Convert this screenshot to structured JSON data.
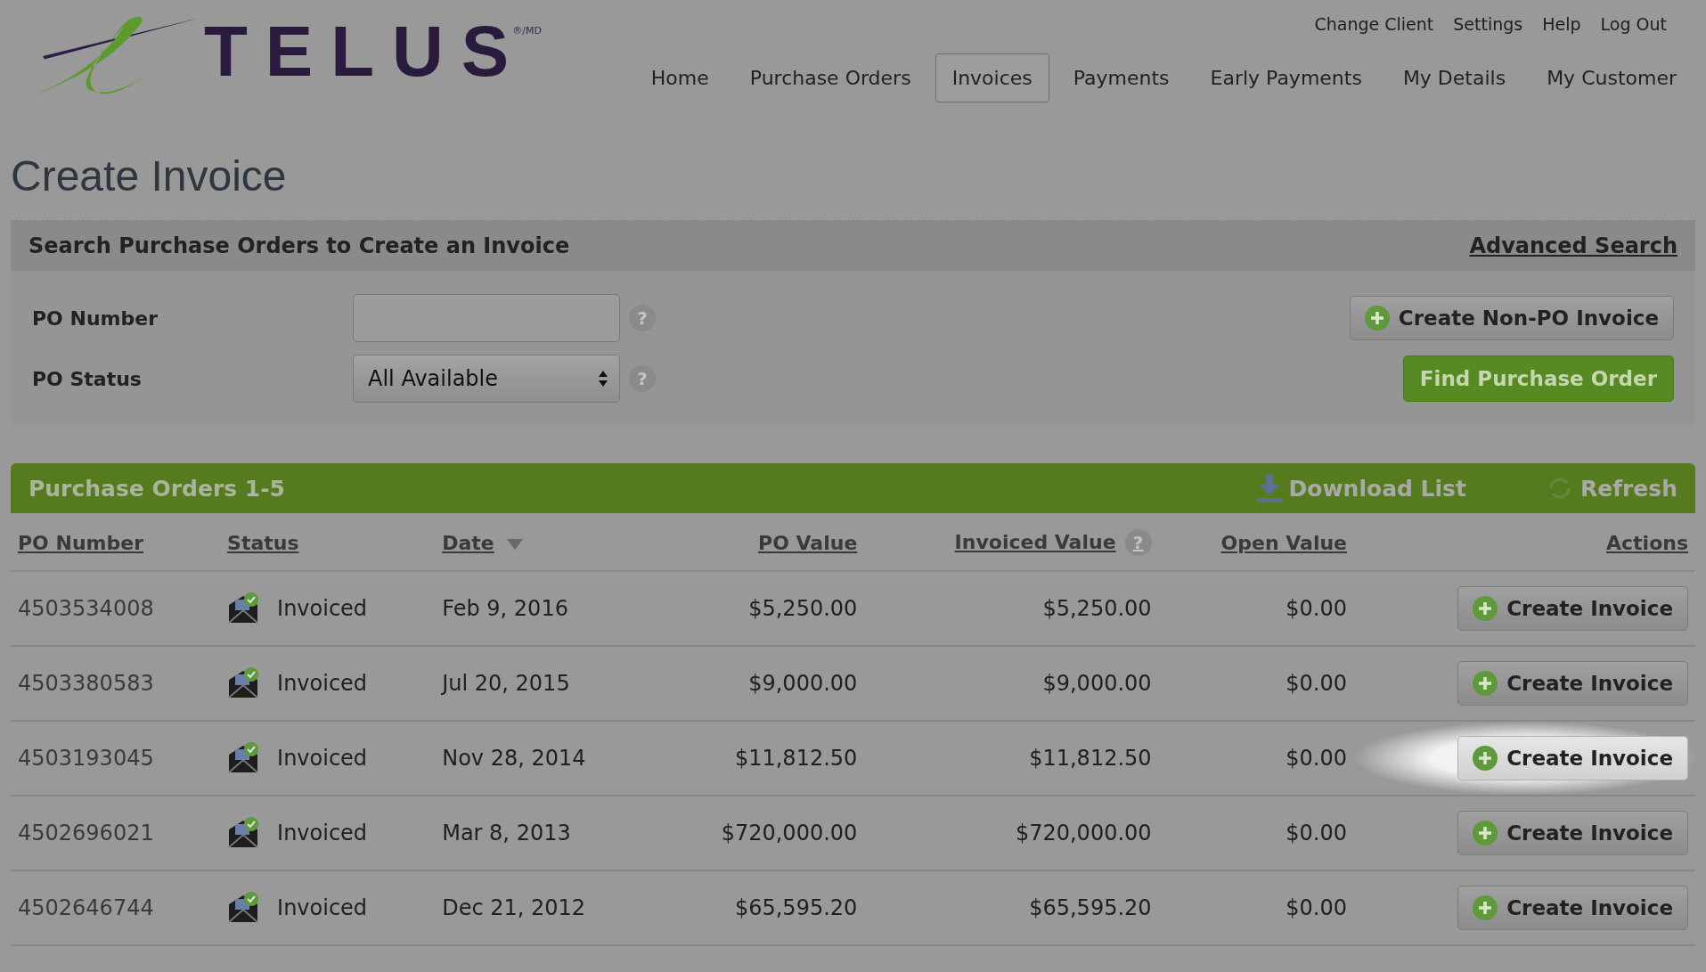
{
  "logo": {
    "wordmark": "TELUS",
    "mark": "®/MD"
  },
  "utility_nav": [
    "Change Client",
    "Settings",
    "Help",
    "Log Out"
  ],
  "main_nav": [
    {
      "label": "Home",
      "selected": false
    },
    {
      "label": "Purchase Orders",
      "selected": false
    },
    {
      "label": "Invoices",
      "selected": true
    },
    {
      "label": "Payments",
      "selected": false
    },
    {
      "label": "Early Payments",
      "selected": false
    },
    {
      "label": "My Details",
      "selected": false
    },
    {
      "label": "My Customer",
      "selected": false
    }
  ],
  "page_title": "Create Invoice",
  "search": {
    "title": "Search Purchase Orders to Create an Invoice",
    "advanced_link": "Advanced Search",
    "po_number_label": "PO Number",
    "po_status_label": "PO Status",
    "po_status_value": "All Available",
    "help_mark": "?",
    "non_po_button": "Create Non-PO Invoice",
    "find_button": "Find Purchase Order"
  },
  "list": {
    "title": "Purchase Orders 1-5",
    "download": "Download List",
    "refresh": "Refresh"
  },
  "table": {
    "columns": [
      "PO Number",
      "Status",
      "Date",
      "PO Value",
      "Invoiced Value",
      "Open Value",
      "Actions"
    ],
    "rows": [
      {
        "po_number": "4503534008",
        "status": "Invoiced",
        "date": "Feb 9, 2016",
        "po_value": "$5,250.00",
        "invoiced_value": "$5,250.00",
        "open_value": "$0.00",
        "action": "Create Invoice",
        "highlighted": false
      },
      {
        "po_number": "4503380583",
        "status": "Invoiced",
        "date": "Jul 20, 2015",
        "po_value": "$9,000.00",
        "invoiced_value": "$9,000.00",
        "open_value": "$0.00",
        "action": "Create Invoice",
        "highlighted": false
      },
      {
        "po_number": "4503193045",
        "status": "Invoiced",
        "date": "Nov 28, 2014",
        "po_value": "$11,812.50",
        "invoiced_value": "$11,812.50",
        "open_value": "$0.00",
        "action": "Create Invoice",
        "highlighted": true
      },
      {
        "po_number": "4502696021",
        "status": "Invoiced",
        "date": "Mar 8, 2013",
        "po_value": "$720,000.00",
        "invoiced_value": "$720,000.00",
        "open_value": "$0.00",
        "action": "Create Invoice",
        "highlighted": false
      },
      {
        "po_number": "4502646744",
        "status": "Invoiced",
        "date": "Dec 21, 2012",
        "po_value": "$65,595.20",
        "invoiced_value": "$65,595.20",
        "open_value": "$0.00",
        "action": "Create Invoice",
        "highlighted": false
      }
    ]
  }
}
